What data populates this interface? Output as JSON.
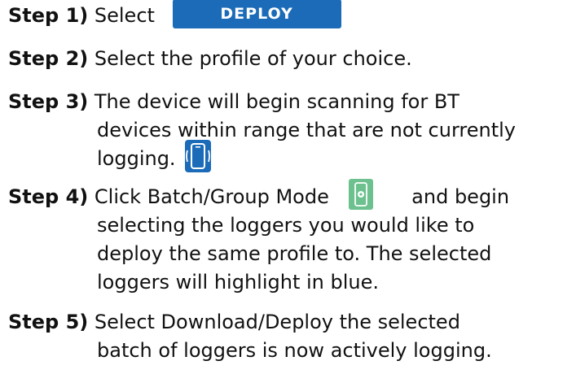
{
  "steps": [
    {
      "label": "Step 1)",
      "text": "Select",
      "button_label": "DEPLOY"
    },
    {
      "label": "Step 2)",
      "text": "Select the profile of your choice."
    },
    {
      "label": "Step 3)",
      "lines": [
        "The device will begin scanning for BT",
        "devices within range that are not currently",
        "logging."
      ],
      "icon": "bluetooth-device-icon"
    },
    {
      "label": "Step 4)",
      "lines": [
        "Click Batch/Group Mode",
        "and begin",
        "selecting the loggers you would like to",
        "deploy the same profile to. The selected",
        "loggers will highlight in blue."
      ],
      "icon": "batch-mode-icon"
    },
    {
      "label": "Step 5)",
      "lines": [
        "Select Download/Deploy the selected",
        "batch of loggers is now actively logging."
      ]
    }
  ],
  "colors": {
    "deploy_button": "#1b6bb8",
    "device_icon": "#1b6bb8",
    "batch_icon": "#6cc18f"
  }
}
